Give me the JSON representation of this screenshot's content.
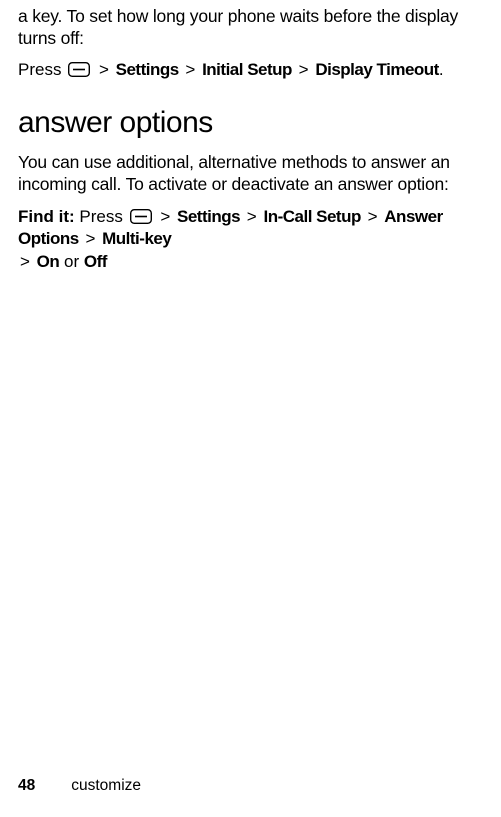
{
  "intro": {
    "continuation": "a key. To set how long your phone waits before the display turns off:",
    "press_word": "Press",
    "path1": {
      "settings": "Settings",
      "initial_setup": "Initial Setup",
      "display_timeout": "Display Timeout"
    }
  },
  "section": {
    "title": "answer options",
    "desc": "You can use additional, alternative methods to answer an incoming call. To activate or deactivate an answer option:",
    "find_it_label": "Find it:",
    "press_word": "Press",
    "path2": {
      "settings": "Settings",
      "incall": "In-Call Setup",
      "answer_options": "Answer Options",
      "multi_key": "Multi-key",
      "on": "On",
      "or": "or",
      "off": "Off"
    }
  },
  "footer": {
    "page": "48",
    "section": "customize"
  },
  "symbols": {
    "gt": ">",
    "period": "."
  }
}
